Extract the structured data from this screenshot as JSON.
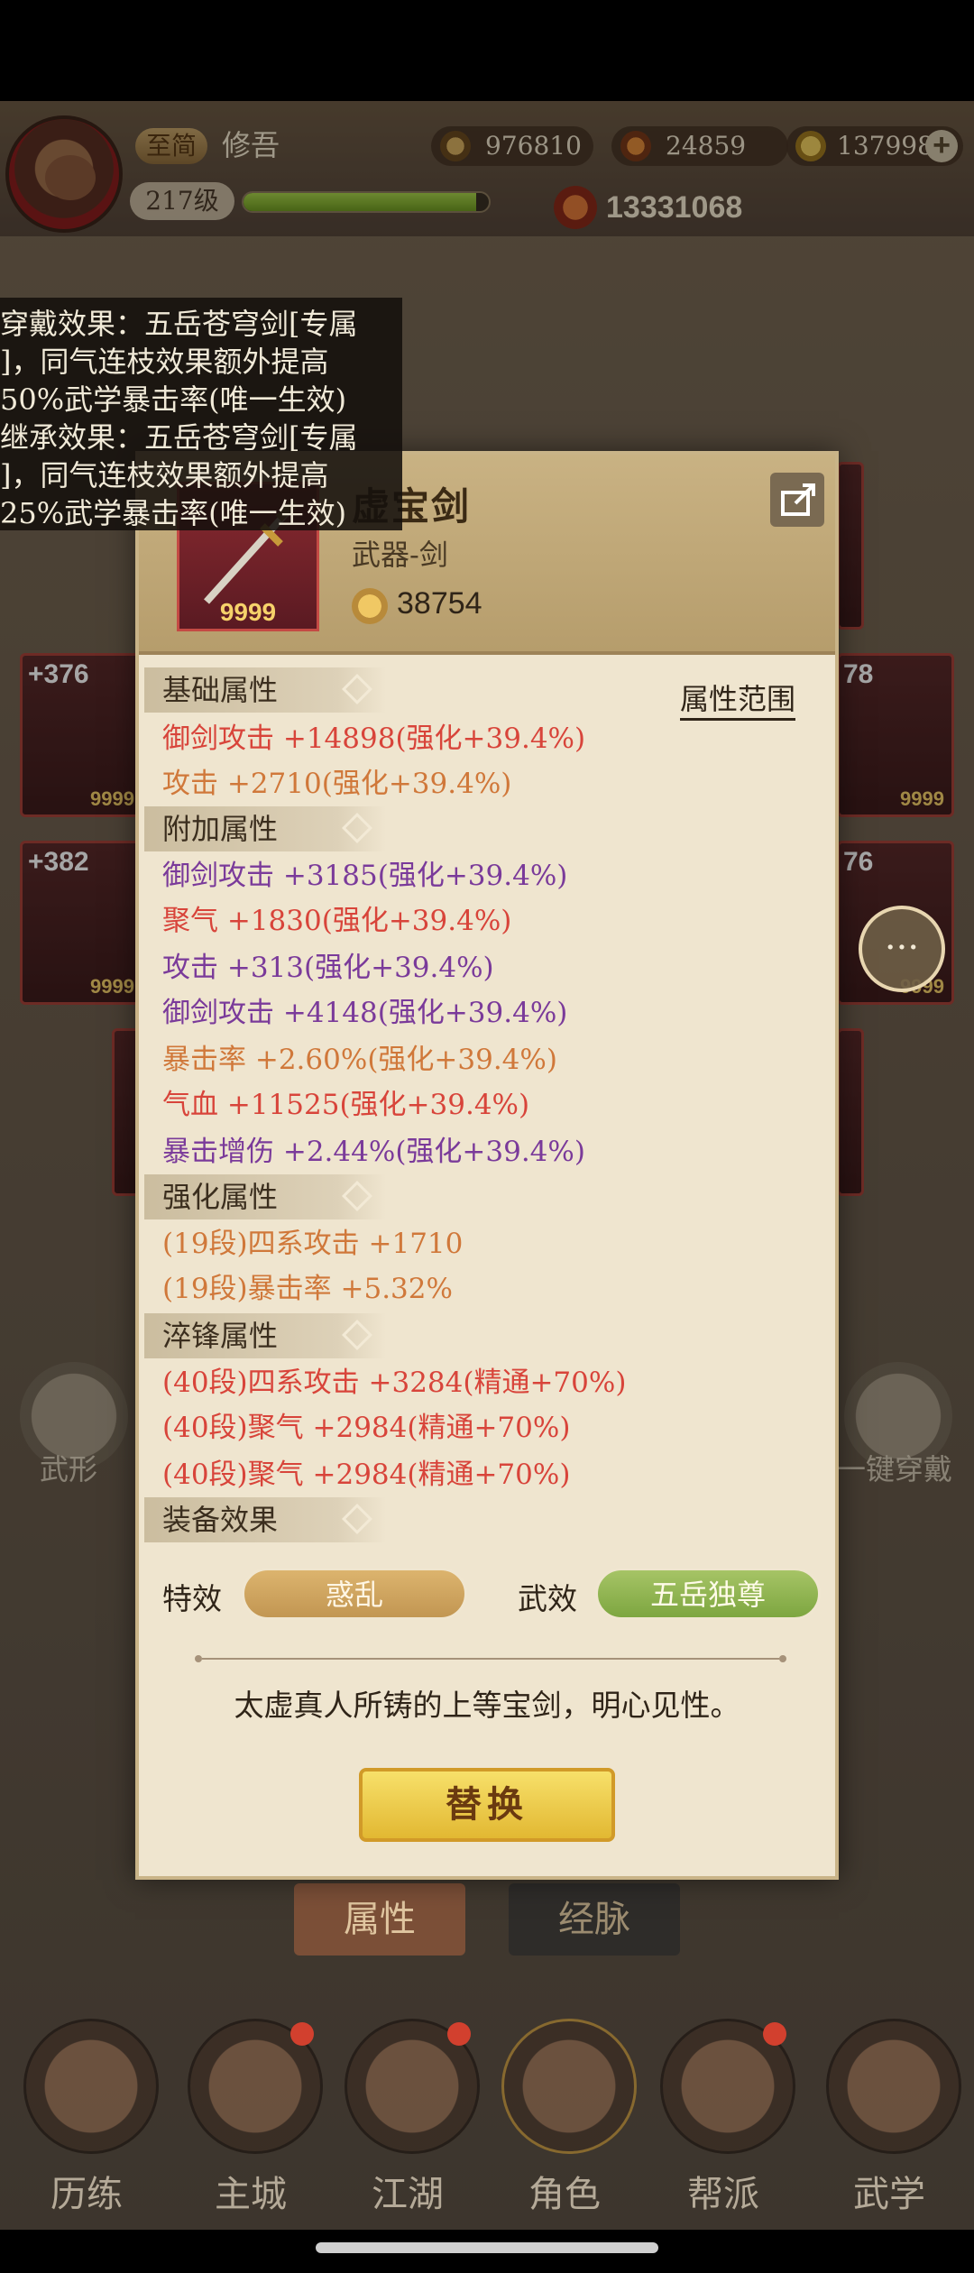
{
  "player": {
    "vip_label": "至简",
    "name": "修吾",
    "level": "217级",
    "exp_fraction": 0.95,
    "power": "13331068"
  },
  "resources": [
    {
      "value": "976810",
      "icon": "coin-icon"
    },
    {
      "value": "24859",
      "icon": "ingot-icon"
    },
    {
      "value": "137998",
      "icon": "gold-icon"
    }
  ],
  "tooltip": {
    "lines": [
      "穿戴效果：五岳苍穹剑[专属",
      "]，同气连枝效果额外提高",
      "50%武学暴击率(唯一生效)",
      "继承效果：五岳苍穹剑[专属",
      "]，同气连枝效果额外提高",
      "25%武学暴击率(唯一生效)"
    ]
  },
  "slots": {
    "left": [
      {
        "level": "+376",
        "count": "9999"
      },
      {
        "level": "+382",
        "count": "9999"
      }
    ],
    "right": [
      {
        "level": "78",
        "count": "9999"
      },
      {
        "level": "76",
        "count": "9999"
      }
    ]
  },
  "side_buttons": {
    "left": "武形",
    "right": "一键穿戴"
  },
  "item": {
    "name": "虚宝剑",
    "type": "武器-剑",
    "score": "38754",
    "icon_count": "9999",
    "range_link": "属性范围",
    "sections": {
      "base": "基础属性",
      "extra": "附加属性",
      "enhance": "强化属性",
      "temper": "淬锋属性",
      "equip_effect": "装备效果"
    },
    "base_attrs": [
      {
        "name": "御剑攻击",
        "value": "+14898(强化+39.4%)",
        "color": "#d8443a"
      },
      {
        "name": "攻击",
        "value": "+2710(强化+39.4%)",
        "color": "#d0783a"
      }
    ],
    "extra_attrs": [
      {
        "name": "御剑攻击",
        "value": "+3185(强化+39.4%)",
        "color": "#7a3a9a"
      },
      {
        "name": "聚气",
        "value": "+1830(强化+39.4%)",
        "color": "#d8443a"
      },
      {
        "name": "攻击",
        "value": "+313(强化+39.4%)",
        "color": "#7a3a9a"
      },
      {
        "name": "御剑攻击",
        "value": "+4148(强化+39.4%)",
        "color": "#7a3a9a"
      },
      {
        "name": "暴击率",
        "value": "+2.60%(强化+39.4%)",
        "color": "#d0783a"
      },
      {
        "name": "气血",
        "value": "+11525(强化+39.4%)",
        "color": "#d8443a"
      },
      {
        "name": "暴击增伤",
        "value": "+2.44%(强化+39.4%)",
        "color": "#7a3a9a"
      }
    ],
    "enhance_attrs": [
      {
        "name": "(19段)四系攻击",
        "value": "+1710",
        "color": "#d0783a"
      },
      {
        "name": "(19段)暴击率",
        "value": "+5.32%",
        "color": "#d0783a"
      }
    ],
    "temper_attrs": [
      {
        "name": "(40段)四系攻击",
        "value": "+3284(精通+70%)",
        "color": "#d8443a"
      },
      {
        "name": "(40段)聚气",
        "value": "+2984(精通+70%)",
        "color": "#d8443a"
      },
      {
        "name": "(40段)聚气",
        "value": "+2984(精通+70%)",
        "color": "#d8443a"
      }
    ],
    "special_label": "特效",
    "special_value": "惑乱",
    "martial_label": "武效",
    "martial_value": "五岳独尊",
    "description": "太虚真人所铸的上等宝剑，明心见性。",
    "replace_label": "替换"
  },
  "bottom_tabs": [
    "属性",
    "经脉"
  ],
  "nav": [
    {
      "label": "历练",
      "dot": false
    },
    {
      "label": "主城",
      "dot": true
    },
    {
      "label": "江湖",
      "dot": true
    },
    {
      "label": "角色",
      "dot": false
    },
    {
      "label": "帮派",
      "dot": true
    },
    {
      "label": "武学",
      "dot": false
    }
  ]
}
